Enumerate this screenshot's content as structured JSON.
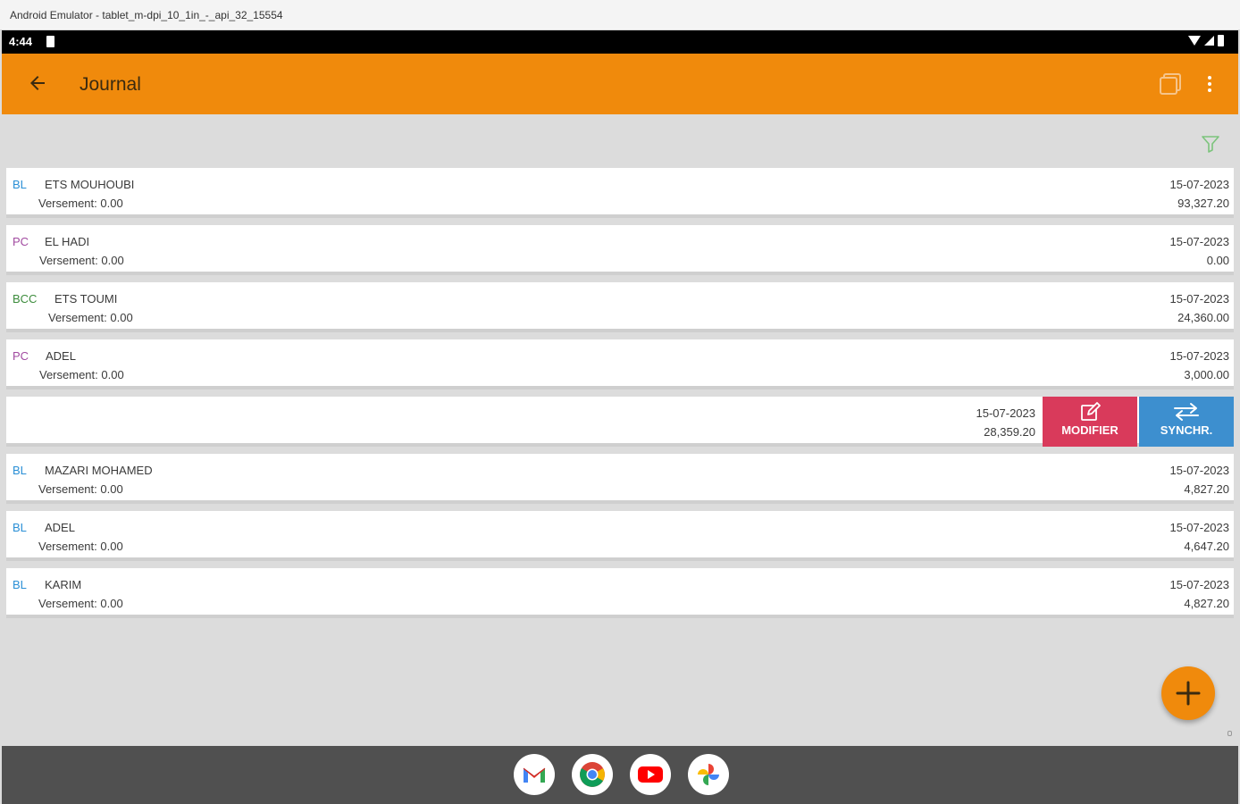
{
  "window": {
    "title": "Android Emulator - tablet_m-dpi_10_1in_-_api_32_15554"
  },
  "status_bar": {
    "time": "4:44"
  },
  "appbar": {
    "title": "Journal"
  },
  "colors": {
    "accent": "#f08a0c",
    "modify": "#d93a5b",
    "sync": "#3d8fcf",
    "bl": "#2a8fd6",
    "pc": "#a14aa0",
    "bcc": "#3c8c3c"
  },
  "rows": [
    {
      "type": "BL",
      "name": "ETS MOUHOUBI",
      "versement": "Versement: 0.00",
      "date": "15-07-2023",
      "amount": "93,327.20"
    },
    {
      "type": "PC",
      "name": "EL HADI",
      "versement": "Versement: 0.00",
      "date": "15-07-2023",
      "amount": "0.00"
    },
    {
      "type": "BCC",
      "name": "ETS TOUMI",
      "versement": "Versement: 0.00",
      "date": "15-07-2023",
      "amount": "24,360.00"
    },
    {
      "type": "PC",
      "name": "ADEL",
      "versement": "Versement: 0.00",
      "date": "15-07-2023",
      "amount": "3,000.00"
    },
    {
      "date": "15-07-2023",
      "amount": "28,359.20",
      "modify_label": "MODIFIER",
      "sync_label": "SYNCHR."
    },
    {
      "type": "BL",
      "name": "MAZARI MOHAMED",
      "versement": "Versement: 0.00",
      "date": "15-07-2023",
      "amount": "4,827.20"
    },
    {
      "type": "BL",
      "name": "ADEL",
      "versement": "Versement: 0.00",
      "date": "15-07-2023",
      "amount": "4,647.20"
    },
    {
      "type": "BL",
      "name": "KARIM",
      "versement": "Versement: 0.00",
      "date": "15-07-2023",
      "amount": "4,827.20"
    }
  ],
  "dock": {
    "apps": [
      "gmail-icon",
      "chrome-icon",
      "youtube-icon",
      "photos-icon"
    ]
  }
}
